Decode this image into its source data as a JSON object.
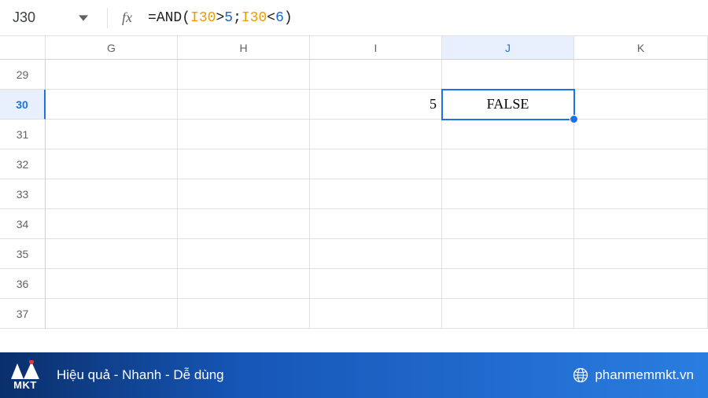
{
  "formula_bar": {
    "cell_ref": "J30",
    "fx_label": "fx",
    "formula": {
      "eq": "=",
      "fn": "AND",
      "open": "(",
      "ref1": "I30",
      "op1": ">",
      "num1": "5",
      "sep": ";",
      "ref2": "I30",
      "op2": "<",
      "num2": "6",
      "close": ")"
    }
  },
  "columns": [
    {
      "label": "G",
      "width": 168
    },
    {
      "label": "H",
      "width": 168
    },
    {
      "label": "I",
      "width": 168
    },
    {
      "label": "J",
      "width": 168,
      "active": true
    },
    {
      "label": "K",
      "width": 170
    }
  ],
  "rows": [
    {
      "num": "29"
    },
    {
      "num": "30",
      "active": true,
      "cells": {
        "I": {
          "v": "5",
          "align": "num"
        },
        "J": {
          "v": "FALSE",
          "align": "txt-center",
          "selected": true
        }
      }
    },
    {
      "num": "31"
    },
    {
      "num": "32"
    },
    {
      "num": "33"
    },
    {
      "num": "34"
    },
    {
      "num": "35"
    },
    {
      "num": "36"
    },
    {
      "num": "37"
    }
  ],
  "footer": {
    "logo_text": "MKT",
    "slogan": "Hiệu quả - Nhanh  - Dễ dùng",
    "site": "phanmemmkt.vn"
  }
}
